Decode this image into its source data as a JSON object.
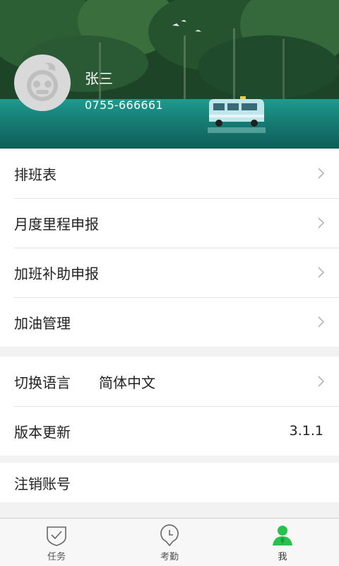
{
  "profile": {
    "name": "张三",
    "phone": "0755-666661"
  },
  "menu_group_1": [
    {
      "label": "排班表"
    },
    {
      "label": "月度里程申报"
    },
    {
      "label": "加班补助申报"
    },
    {
      "label": "加油管理"
    }
  ],
  "settings": {
    "language_label": "切换语言",
    "language_value": "简体中文",
    "version_label": "版本更新",
    "version_value": "3.1.1"
  },
  "account": {
    "logout_label": "注销账号"
  },
  "tabs": [
    {
      "label": "任务",
      "icon": "task-shield-icon"
    },
    {
      "label": "考勤",
      "icon": "attendance-clock-icon"
    },
    {
      "label": "我",
      "icon": "person-icon"
    }
  ],
  "colors": {
    "accent": "#27c24c",
    "chevron": "#b5b5b5",
    "text": "#222222",
    "background": "#f2f2f2"
  }
}
